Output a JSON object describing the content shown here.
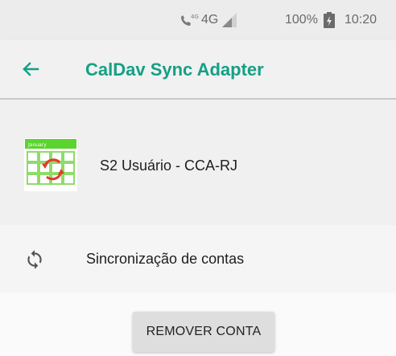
{
  "status_bar": {
    "network_type": "4G",
    "battery": "100%",
    "time": "10:20"
  },
  "app_bar": {
    "title": "CalDav Sync Adapter",
    "back_icon": "arrow-left-icon",
    "accent_color": "#14a085"
  },
  "account": {
    "name": "S2 Usuário - CCA-RJ",
    "icon": "calendar-sync-icon",
    "icon_header_text": "January"
  },
  "sync": {
    "label": "Sincronização de contas",
    "icon": "sync-icon"
  },
  "actions": {
    "remove_label": "REMOVER CONTA"
  }
}
